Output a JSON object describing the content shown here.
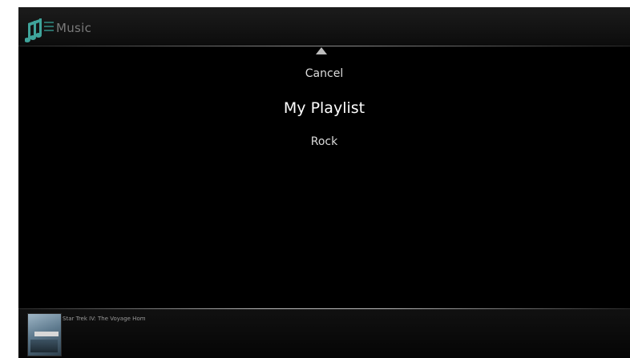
{
  "header": {
    "title": "Music",
    "icon": "music-notes-icon",
    "accent_color": "#3fa39a"
  },
  "menu": {
    "scroll_indicator": "up-arrow-icon",
    "items": [
      {
        "label": "Cancel",
        "selected": false
      },
      {
        "label": "My Playlist",
        "selected": true
      },
      {
        "label": "Rock",
        "selected": false
      }
    ]
  },
  "footer": {
    "now_playing_title": "Star Trek IV: The Voyage Hom",
    "thumbnail": "album-art-thumbnail"
  }
}
